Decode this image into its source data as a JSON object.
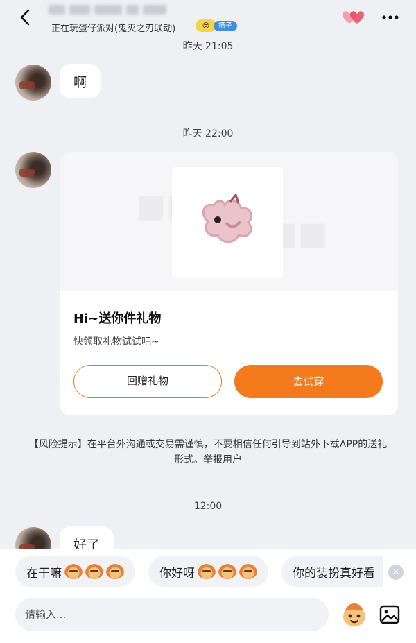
{
  "header": {
    "status_text": "正在玩蛋仔派对(鬼灭之刃联动)",
    "badge_tag": "搭子",
    "icons": [
      "back-icon",
      "hearts-icon",
      "more-icon"
    ]
  },
  "messages": [
    {
      "time": "昨天 21:05",
      "text": "啊"
    },
    {
      "time": "昨天 22:00"
    },
    {
      "time": "12:00",
      "text": "好了"
    }
  ],
  "gift_card": {
    "title": "Hi~送你件礼物",
    "subtitle": "快领取礼物试试吧~",
    "return_gift_label": "回赠礼物",
    "try_on_label": "去试穿"
  },
  "risk_notice": {
    "text": "【风险提示】在平台外沟通或交易需谨慎，不要相信任何引导到站外下载APP的送礼形式。",
    "report_link": "举报用户"
  },
  "quick_replies": [
    {
      "text": "在干嘛"
    },
    {
      "text": "你好呀"
    },
    {
      "text": "你的装扮真好看"
    }
  ],
  "composer": {
    "placeholder": "请输入..."
  },
  "colors": {
    "accent": "#f47a1b",
    "background": "#eef0f4",
    "badge_blue": "#3d8fe6"
  }
}
